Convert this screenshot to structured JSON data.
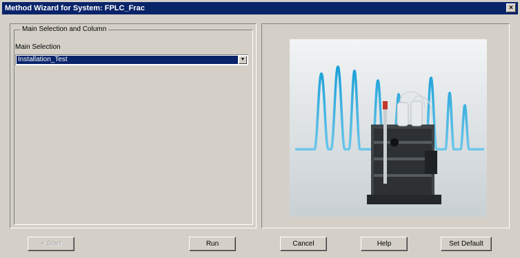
{
  "window": {
    "title": "Method Wizard for System: FPLC_Frac",
    "close_glyph": "×"
  },
  "left_panel": {
    "group_title": "Main Selection and Column",
    "main_selection_label": "Main Selection",
    "main_selection_value": "Installation_Test",
    "dropdown_glyph": "▼"
  },
  "buttons": {
    "start": "< Start",
    "run": "Run",
    "cancel": "Cancel",
    "help": "Help",
    "set_default": "Set Default"
  },
  "colors": {
    "titlebar": "#0a246a",
    "selection": "#0a246a",
    "peak": "#1aa0d8"
  },
  "image": {
    "icon": "fplc-instrument-with-chromatogram-peaks"
  }
}
